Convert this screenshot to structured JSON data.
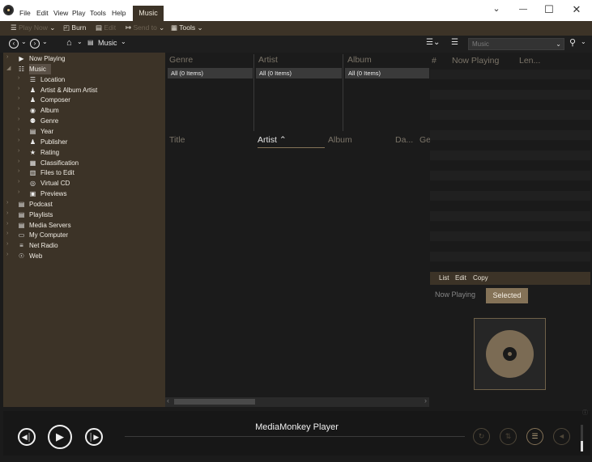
{
  "menu": [
    "File",
    "Edit",
    "View",
    "Play",
    "Tools",
    "Help"
  ],
  "active_tab": "Music",
  "window_controls": {
    "dropdown": "⌄",
    "minimize": "—",
    "maximize": "☐",
    "close": "✕"
  },
  "toolbar": {
    "play_now": "Play Now",
    "burn": "Burn",
    "edit": "Edit",
    "send_to": "Send to",
    "tools": "Tools"
  },
  "navbar": {
    "location": "Music",
    "search_placeholder": "Music"
  },
  "tree": [
    {
      "label": "Now Playing",
      "icon": "now-playing-icon",
      "glyph": "▶",
      "level": 0,
      "expander": "›"
    },
    {
      "label": "Music",
      "icon": "music-icon",
      "glyph": "☷",
      "level": 0,
      "expander": "◢"
    },
    {
      "label": "Location",
      "icon": "location-icon",
      "glyph": "☰",
      "level": 1,
      "expander": "›"
    },
    {
      "label": "Artist & Album Artist",
      "icon": "artist-icon",
      "glyph": "♟",
      "level": 1,
      "expander": "›"
    },
    {
      "label": "Composer",
      "icon": "composer-icon",
      "glyph": "♟",
      "level": 1,
      "expander": "›"
    },
    {
      "label": "Album",
      "icon": "album-icon",
      "glyph": "◉",
      "level": 1,
      "expander": "›"
    },
    {
      "label": "Genre",
      "icon": "genre-icon",
      "glyph": "⚉",
      "level": 1,
      "expander": "›"
    },
    {
      "label": "Year",
      "icon": "year-icon",
      "glyph": "▤",
      "level": 1,
      "expander": "›"
    },
    {
      "label": "Publisher",
      "icon": "publisher-icon",
      "glyph": "♟",
      "level": 1,
      "expander": "›"
    },
    {
      "label": "Rating",
      "icon": "rating-icon",
      "glyph": "★",
      "level": 1,
      "expander": "›"
    },
    {
      "label": "Classification",
      "icon": "classification-icon",
      "glyph": "▦",
      "level": 1,
      "expander": "›"
    },
    {
      "label": "Files to Edit",
      "icon": "files-to-edit-icon",
      "glyph": "▥",
      "level": 1,
      "expander": "›"
    },
    {
      "label": "Virtual CD",
      "icon": "virtual-cd-icon",
      "glyph": "◎",
      "level": 1,
      "expander": "›"
    },
    {
      "label": "Previews",
      "icon": "previews-icon",
      "glyph": "▣",
      "level": 1,
      "expander": "›"
    },
    {
      "label": "Podcast",
      "icon": "podcast-icon",
      "glyph": "▤",
      "level": 0,
      "expander": "›"
    },
    {
      "label": "Playlists",
      "icon": "playlists-icon",
      "glyph": "▤",
      "level": 0,
      "expander": "›"
    },
    {
      "label": "Media Servers",
      "icon": "media-servers-icon",
      "glyph": "▤",
      "level": 0,
      "expander": "›"
    },
    {
      "label": "My Computer",
      "icon": "my-computer-icon",
      "glyph": "▭",
      "level": 0,
      "expander": "›"
    },
    {
      "label": "Net Radio",
      "icon": "net-radio-icon",
      "glyph": "≡",
      "level": 0,
      "expander": "›"
    },
    {
      "label": "Web",
      "icon": "web-icon",
      "glyph": "☉",
      "level": 0,
      "expander": "›"
    }
  ],
  "browser": {
    "columns": [
      "Genre",
      "Artist",
      "Album"
    ],
    "all_items": "All (0 Items)"
  },
  "tracklist": {
    "columns": [
      "Title",
      "Artist ⌃",
      "Album",
      "Da...",
      "Ge"
    ]
  },
  "now_playing_list": {
    "columns": [
      "#",
      "Now Playing",
      "Len..."
    ]
  },
  "panel": {
    "menu": [
      "List",
      "Edit",
      "Copy"
    ],
    "tabs": [
      "Now Playing",
      "Selected"
    ]
  },
  "player": {
    "title": "MediaMonkey Player"
  },
  "colors": {
    "accent": "#3c3327",
    "tab_selected": "#847257",
    "background": "#1b1b1b"
  }
}
